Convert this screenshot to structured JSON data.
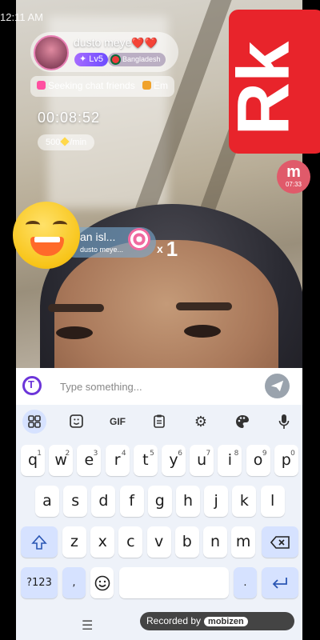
{
  "status": {
    "time": "12:11 AM"
  },
  "host": {
    "name": "dusto meye",
    "name_suffix": "❤️❤️",
    "level": "Lv5",
    "country": "Bangladesh"
  },
  "tags": [
    "Seeking chat friends",
    "Em"
  ],
  "timer": "00:08:52",
  "rate": {
    "amount": "500",
    "unit": "/min"
  },
  "side_bubble": {
    "label": "m",
    "time": "07:33"
  },
  "gift": {
    "line1": "an isl...",
    "line2": "dusto meye...",
    "prefix": "x",
    "count": "1"
  },
  "logo": {
    "text": "Rk"
  },
  "composer": {
    "placeholder": "Type something...",
    "logo_letter": "T"
  },
  "keyboard": {
    "toolbar": [
      "grid-icon",
      "sticker-icon",
      "GIF",
      "clipboard-icon",
      "gear-icon",
      "palette-icon",
      "mic-icon"
    ],
    "gif_label": "GIF",
    "row1": [
      [
        "q",
        "1"
      ],
      [
        "w",
        "2"
      ],
      [
        "e",
        "3"
      ],
      [
        "r",
        "4"
      ],
      [
        "t",
        "5"
      ],
      [
        "y",
        "6"
      ],
      [
        "u",
        "7"
      ],
      [
        "i",
        "8"
      ],
      [
        "o",
        "9"
      ],
      [
        "p",
        "0"
      ]
    ],
    "row2": [
      "a",
      "s",
      "d",
      "f",
      "g",
      "h",
      "j",
      "k",
      "l"
    ],
    "row3": [
      "z",
      "x",
      "c",
      "v",
      "b",
      "n",
      "m"
    ],
    "symbols_label": "?123",
    "comma": ",",
    "period": "."
  },
  "recorder": {
    "text": "Recorded by",
    "brand": "mobizen"
  },
  "nav": {
    "menu_glyph": "☰"
  }
}
